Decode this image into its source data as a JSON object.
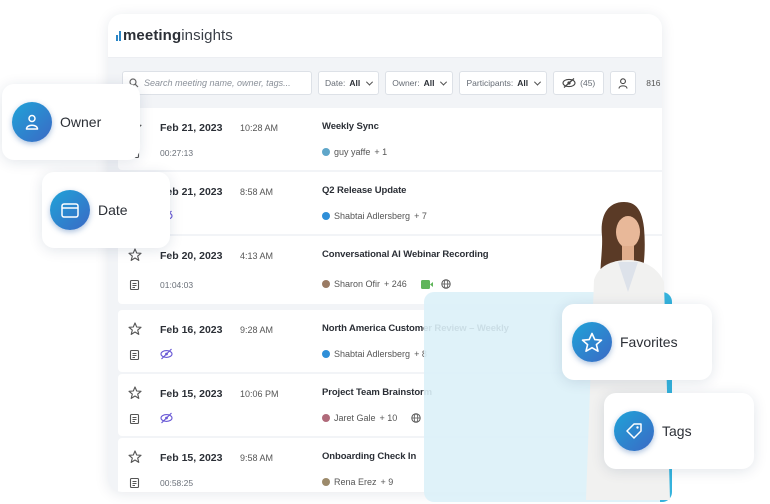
{
  "app": {
    "logo_bold": "meeting",
    "logo_light": "insights",
    "brand_color": "#2b86c6"
  },
  "filters": {
    "search_placeholder": "Search meeting name, owner, tags...",
    "date_label": "Date:",
    "date_value": "All",
    "owner_label": "Owner:",
    "owner_value": "All",
    "participants_label": "Participants:",
    "participants_value": "All",
    "hidden_count": "(45)",
    "total_count": "816"
  },
  "meetings": [
    {
      "date": "Feb 21, 2023",
      "time": "10:28 AM",
      "title": "Weekly Sync",
      "duration": "00:27:13",
      "owner": "guy yaffe",
      "extra": "+ 1",
      "owner_color": "#5fa6c9"
    },
    {
      "date": "Feb 21, 2023",
      "time": "8:58 AM",
      "title": "Q2 Release Update",
      "duration": "",
      "owner": "Shabtai Adlersberg",
      "extra": "+ 7",
      "owner_color": "#2f8fd8"
    },
    {
      "date": "Feb 20, 2023",
      "time": "4:13 AM",
      "title": "Conversational AI Webinar Recording",
      "duration": "01:04:03",
      "owner": "Sharon Ofir",
      "extra": "+ 246",
      "owner_color": "#9a7b64"
    },
    {
      "date": "Feb 16, 2023",
      "time": "9:28 AM",
      "title": "North America Customer Review – Weekly",
      "duration": "",
      "owner": "Shabtai Adlersberg",
      "extra": "+ 8",
      "owner_color": "#2f8fd8"
    },
    {
      "date": "Feb 15, 2023",
      "time": "10:06 PM",
      "title": "Project Team Brainstorm",
      "duration": "",
      "owner": "Jaret Gale",
      "extra": "+ 10",
      "owner_color": "#b06a7a"
    },
    {
      "date": "Feb 15, 2023",
      "time": "9:58 AM",
      "title": "Onboarding Check In",
      "duration": "00:58:25",
      "owner": "Rena Erez",
      "extra": "+ 9",
      "owner_color": "#9c8a6b"
    }
  ],
  "floating": {
    "owner": "Owner",
    "date": "Date",
    "favorites": "Favorites",
    "tags": "Tags",
    "accent": "#1fa3d8"
  },
  "icons": {
    "owner": "person-icon",
    "date": "calendar-icon",
    "favorites": "star-icon",
    "tags": "tag-icon",
    "hidden": "eye-slash-icon",
    "meta": "notes-icon",
    "search": "search-icon"
  }
}
